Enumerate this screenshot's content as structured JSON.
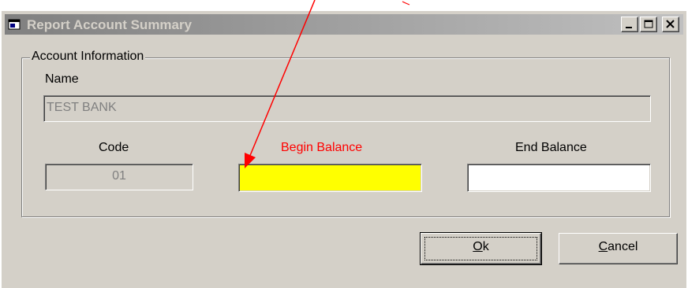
{
  "window": {
    "title": "Report Account Summary",
    "buttons": [
      "minimize",
      "maximize",
      "close"
    ],
    "title_icon": "dialog-window-icon"
  },
  "account_info": {
    "group_label": "Account Information",
    "name_label": "Name",
    "name_value": "TEST BANK",
    "code_label": "Code",
    "code_value": "01",
    "begin_balance_label": "Begin Balance",
    "begin_balance_value": "",
    "end_balance_label": "End Balance",
    "end_balance_value": ""
  },
  "actions": {
    "ok_label": "Ok",
    "ok_mnemonic": "O",
    "cancel_label": "Cancel",
    "cancel_mnemonic": "C"
  },
  "colors": {
    "highlight_field": "#ffff00",
    "annotation": "#ff0000",
    "dialog_bg": "#d4d0c8"
  }
}
